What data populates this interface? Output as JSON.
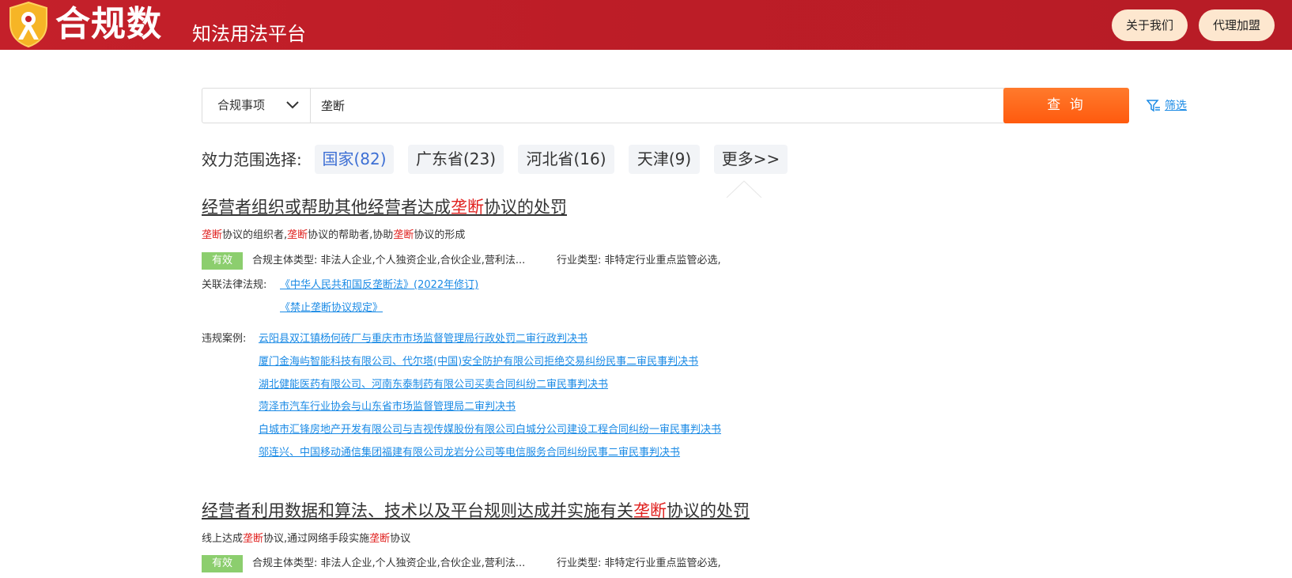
{
  "header": {
    "logo_text": "合规数",
    "slogan": "知法用法平台",
    "nav": [
      "关于我们",
      "代理加盟"
    ],
    "brand_color": "#c4202a"
  },
  "search": {
    "category": "合规事项",
    "query": "垄断",
    "button": "查 询",
    "filter": "筛选"
  },
  "scope": {
    "label": "效力范围选择:",
    "options": [
      {
        "label": "国家(82)",
        "active": true
      },
      {
        "label": "广东省(23)",
        "active": false
      },
      {
        "label": "河北省(16)",
        "active": false
      },
      {
        "label": "天津(9)",
        "active": false
      },
      {
        "label": "更多>>",
        "active": false
      }
    ]
  },
  "results": [
    {
      "title": {
        "before": "经营者组织或帮助其他经营者达成",
        "keyword": "垄断",
        "after": "协议的处罚"
      },
      "desc": [
        "",
        "垄断",
        "协议的组织者,",
        "垄断",
        "协议的帮助者,协助",
        "垄断",
        "协议的形成"
      ],
      "status": "有效",
      "subject_type": "合规主体类型: 非法人企业,个人独资企业,合伙企业,营利法...",
      "industry_type": "行业类型: 非特定行业重点监管必选,",
      "laws_label": "关联法律法规:",
      "laws": [
        "《中华人民共和国反垄断法》(2022年修订)",
        "《禁止垄断协议规定》"
      ],
      "cases_label": "违规案例:",
      "cases": [
        "云阳县双江镇杨何砖厂与重庆市市场监督管理局行政处罚二审行政判决书",
        "厦门金海屿智能科技有限公司、代尔塔(中国)安全防护有限公司拒绝交易纠纷民事二审民事判决书",
        "湖北健能医药有限公司、河南东泰制药有限公司买卖合同纠纷二审民事判决书",
        "菏泽市汽车行业协会与山东省市场监督管理局二审判决书",
        "白城市汇锋房地产开发有限公司与吉视传媒股份有限公司白城分公司建设工程合同纠纷一审民事判决书",
        "邬连兴、中国移动通信集团福建有限公司龙岩分公司等电信服务合同纠纷民事二审民事判决书"
      ]
    },
    {
      "title": {
        "before": "经营者利用数据和算法、技术以及平台规则达成并实施有关",
        "keyword": "垄断",
        "after": "协议的处罚"
      },
      "desc": [
        "线上达成",
        "垄断",
        "协议,通过网络手段实施",
        "垄断",
        "协议"
      ],
      "status": "有效",
      "subject_type": "合规主体类型: 非法人企业,个人独资企业,合伙企业,营利法...",
      "industry_type": "行业类型: 非特定行业重点监管必选,"
    }
  ]
}
